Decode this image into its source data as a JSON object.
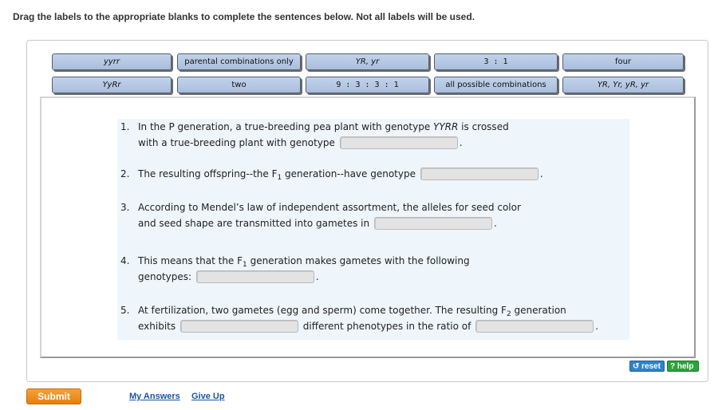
{
  "instructions": "Drag the labels to the appropriate blanks to complete the sentences below. Not all labels will be used.",
  "labels": {
    "yyrr": "yyrr",
    "parental": "parental combinations only",
    "yr_pair": "YR, yr",
    "ratio_31": "3 : 1",
    "four": "four",
    "yyrr2": "YyRr",
    "two": "two",
    "ratio_9331": "9 : 3 : 3 : 1",
    "all_combos": "all possible combinations",
    "four_gametes": "YR, Yr, yR, yr"
  },
  "questions": {
    "q1": {
      "num": "1.",
      "line1_a": "In the P generation, a true-breeding pea plant with genotype ",
      "line1_em": "YYRR",
      "line1_b": " is crossed",
      "line2_a": "with a true-breeding plant with genotype",
      "line2_end": "."
    },
    "q2": {
      "num": "2.",
      "a": "The resulting offspring--the F",
      "sub": "1",
      "b": " generation--have genotype",
      "end": "."
    },
    "q3": {
      "num": "3.",
      "line1": "According to Mendel’s law of independent assortment, the alleles for seed color",
      "line2_a": "and seed shape are transmitted into gametes in",
      "line2_end": "."
    },
    "q4": {
      "num": "4.",
      "a": "This means that the F",
      "sub": "1",
      "b": " generation makes gametes with the following",
      "line2_a": "genotypes:",
      "line2_end": "."
    },
    "q5": {
      "num": "5.",
      "a": "At fertilization, two gametes (egg and sperm) come together. The resulting F",
      "sub": "2",
      "b": " generation",
      "line2_a": "exhibits",
      "line2_mid": "different phenotypes in the ratio of",
      "line2_end": "."
    }
  },
  "buttons": {
    "reset": "reset",
    "reset_icon": "↺",
    "help": "help",
    "help_icon": "?",
    "submit": "Submit"
  },
  "links": {
    "my_answers": "My Answers",
    "give_up": "Give Up"
  },
  "colors": {
    "label_bg": "#b5c8e4",
    "submit_bg": "#ee8c20",
    "reset_bg": "#2f83c9",
    "help_bg": "#2aa43c",
    "link": "#1a55a8"
  }
}
